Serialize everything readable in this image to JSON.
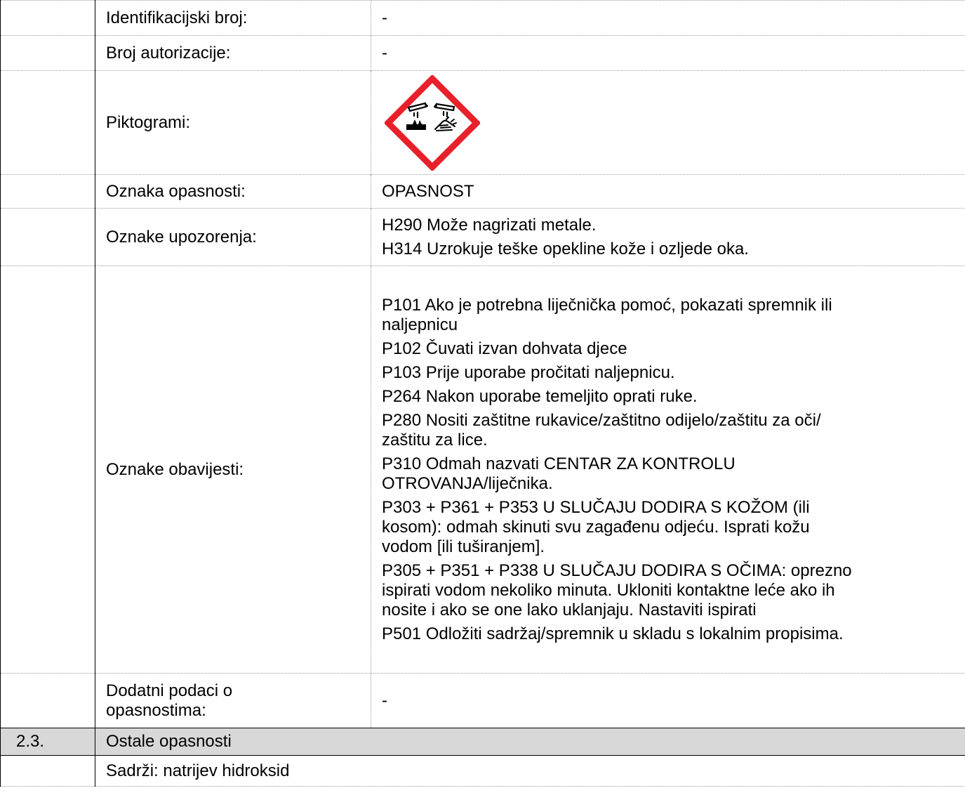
{
  "rows": {
    "identification": {
      "label": "Identifikacijski broj:",
      "value": "-"
    },
    "authorization": {
      "label": "Broj autorizacije:",
      "value": "-"
    },
    "pictograms": {
      "label": "Piktogrami:",
      "icon": "ghs05-corrosion-icon",
      "color": "#e8202a"
    },
    "signal_word": {
      "label": "Oznaka opasnosti:",
      "value": "OPASNOST"
    },
    "hazard_statements": {
      "label": "Oznake upozorenja:",
      "items": [
        "H290 Može nagrizati metale.",
        "H314 Uzrokuje teške opekline kože i ozljede oka."
      ]
    },
    "precautionary_statements": {
      "label": "Oznake obavijesti:",
      "lines": [
        "P101 Ako je potrebna liječnička pomoć, pokazati spremnik ili",
        "naljepnicu",
        "P102 Čuvati izvan dohvata djece",
        "P103 Prije uporabe pročitati naljepnicu.",
        "P264 Nakon uporabe temeljito oprati ruke.",
        "P280 Nositi zaštitne rukavice/zaštitno odijelo/zaštitu za oči/",
        "zaštitu za lice.",
        "P310 Odmah nazvati CENTAR ZA KONTROLU",
        "OTROVANJA/liječnika.",
        "P303 + P361 + P353 U SLUČAJU DODIRA S KOŽOM (ili",
        "kosom): odmah skinuti svu zagađenu odjeću. Isprati kožu",
        "vodom [ili tuširanjem].",
        "P305 + P351 + P338 U SLUČAJU DODIRA S OČIMA: oprezno",
        "ispirati vodom nekoliko minuta. Ukloniti kontaktne leće ako ih",
        "nosite i ako se one lako uklanjaju. Nastaviti ispirati",
        "P501 Odložiti sadržaj/spremnik u skladu s lokalnim propisima."
      ]
    },
    "additional_info": {
      "label_line1": "Dodatni podaci o",
      "label_line2": "opasnostima:",
      "value": "-"
    }
  },
  "section_2_3": {
    "number": "2.3.",
    "title": "Ostale opasnosti"
  },
  "contains": {
    "text": "Sadrži: natrijev hidroksid"
  }
}
